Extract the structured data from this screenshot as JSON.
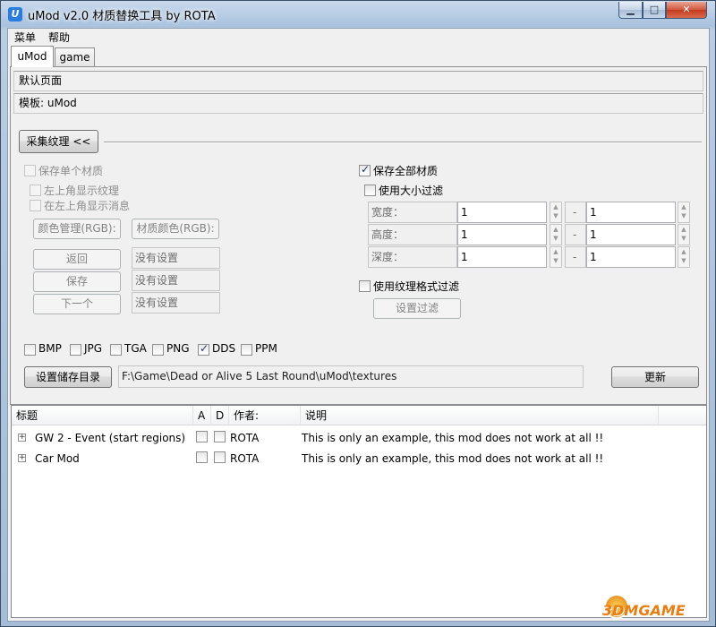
{
  "window": {
    "title": "uMod v2.0 材质替换工具 by ROTA",
    "icon": "U"
  },
  "caption_buttons": {
    "minimize": "▁",
    "maximize": "□",
    "close": "✕"
  },
  "menu": [
    "菜单",
    "帮助"
  ],
  "tabs": [
    "uMod",
    "game"
  ],
  "info": {
    "default_page": "默认页面",
    "template": "模板: uMod"
  },
  "collect": {
    "button": "采集纹理 <<",
    "save_single": "保存单个材质",
    "show_texture_topleft": "左上角显示纹理",
    "show_message_topleft": "在左上角显示消息",
    "color_manage": "颜色管理(RGB):",
    "texture_color": "材质颜色(RGB):",
    "back": "返回",
    "save": "保存",
    "next": "下一个",
    "not_set_1": "没有设置",
    "not_set_2": "没有设置",
    "not_set_3": "没有设置",
    "save_all": "保存全部材质",
    "save_all_checked": true,
    "size_filter": "使用大小过滤",
    "width_label": "宽度：",
    "height_label": "高度：",
    "depth_label": "深度：",
    "width_min": "1",
    "width_max": "1",
    "height_min": "1",
    "height_max": "1",
    "depth_min": "1",
    "depth_max": "1",
    "dash": "-",
    "format_filter": "使用纹理格式过滤",
    "set_filter": "设置过滤"
  },
  "formats": [
    {
      "label": "BMP",
      "checked": false
    },
    {
      "label": "JPG",
      "checked": false
    },
    {
      "label": "TGA",
      "checked": false
    },
    {
      "label": "PNG",
      "checked": false
    },
    {
      "label": "DDS",
      "checked": true
    },
    {
      "label": "PPM",
      "checked": false
    }
  ],
  "save_dir": {
    "button": "设置储存目录",
    "path": "F:\\Game\\Dead or Alive 5 Last Round\\uMod\\textures",
    "update": "更新"
  },
  "list": {
    "headers": [
      "标题",
      "A",
      "D",
      "作者:",
      "说明"
    ],
    "rows": [
      {
        "title": "GW 2 - Event  (start regions)",
        "author": "ROTA",
        "desc": "This is only an example, this mod does not work at all !!"
      },
      {
        "title": "Car Mod",
        "author": "ROTA",
        "desc": "This is only an example, this mod does not work at all !!"
      }
    ]
  },
  "watermark": "3DMGAME"
}
